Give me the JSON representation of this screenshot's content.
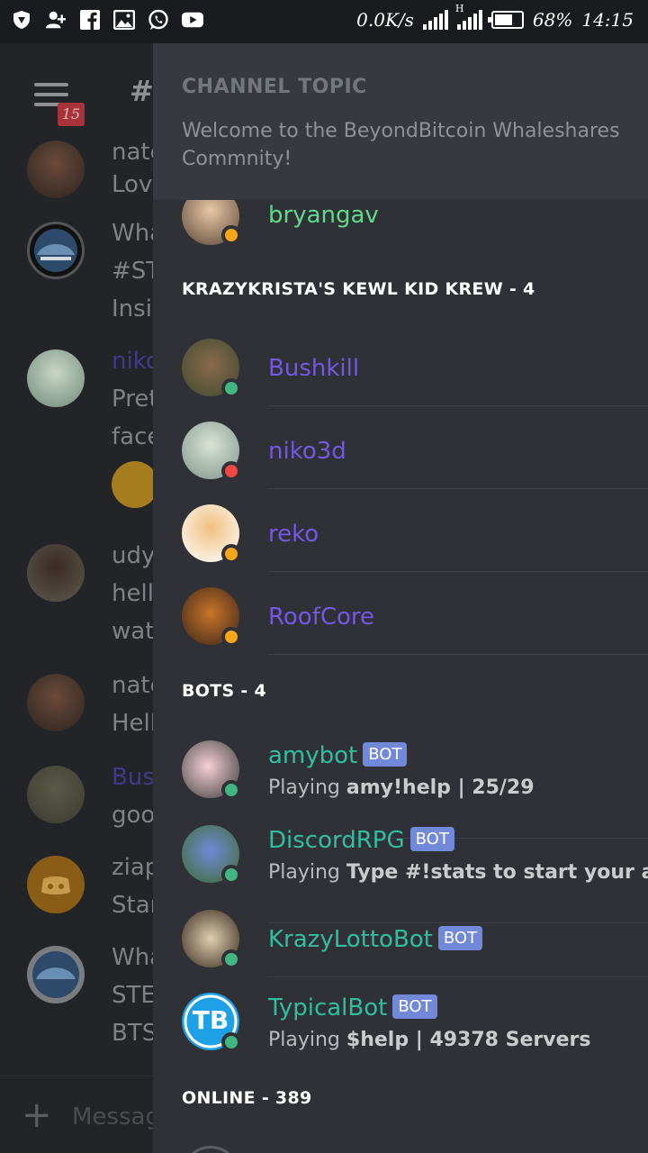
{
  "status_bar": {
    "net_speed": "0.0K/s",
    "net_type": "H",
    "battery": "68%",
    "battery_level": 0.68,
    "time": "14:15",
    "icons": [
      "shield-icon",
      "add-person-icon",
      "facebook-icon",
      "image-icon",
      "whatsapp-icon",
      "youtube-icon"
    ]
  },
  "chat": {
    "unread_badge": "15",
    "channel_hash": "#",
    "message_placeholder": "Messag",
    "fragments": [
      [
        "nate",
        "Love"
      ],
      [
        "Wha",
        "#ST",
        "Insid"
      ],
      [
        "niko",
        "Pret",
        "face"
      ],
      [
        "udy",
        "hell",
        "wata"
      ],
      [
        "nate",
        "Hell"
      ],
      [
        "Busk",
        "good"
      ],
      [
        "ziap",
        "Star"
      ],
      [
        "Wha",
        "STE",
        "BTS"
      ]
    ]
  },
  "drawer": {
    "topic_title": "CHANNEL TOPIC",
    "topic_text": "Welcome to the BeyondBitcoin Whaleshares Commnity!",
    "top_member": {
      "name": "bryangav",
      "status": "idle"
    },
    "sections": [
      {
        "title": "KRAZYKRISTA'S KEWL KID KREW - 4",
        "members": [
          {
            "name": "Bushkill",
            "status": "online"
          },
          {
            "name": "niko3d",
            "status": "dnd"
          },
          {
            "name": "reko",
            "status": "idle"
          },
          {
            "name": "RoofCore",
            "status": "idle"
          }
        ]
      },
      {
        "title": "BOTS - 4",
        "members": [
          {
            "name": "amybot",
            "tag": "BOT",
            "status": "online",
            "activity_prefix": "Playing ",
            "activity": "amy!help | 25/29"
          },
          {
            "name": "DiscordRPG",
            "tag": "BOT",
            "status": "online",
            "activity_prefix": "Playing ",
            "activity": "Type #!stats to start your adv..."
          },
          {
            "name": "KrazyLottoBot",
            "tag": "BOT",
            "status": "online"
          },
          {
            "name": "TypicalBot",
            "tag": "BOT",
            "status": "online",
            "activity_prefix": "Playing ",
            "activity": "$help | 49378 Servers",
            "avatar_text": "TB"
          }
        ]
      },
      {
        "title": "ONLINE - 389"
      }
    ]
  },
  "colors": {
    "online": "#43b581",
    "idle": "#faa61a",
    "dnd": "#f04747",
    "role_purple": "#7457e2",
    "bot_teal": "#2fbf9e",
    "member_green": "#5fd98a",
    "bot_tag": "#7289da"
  }
}
